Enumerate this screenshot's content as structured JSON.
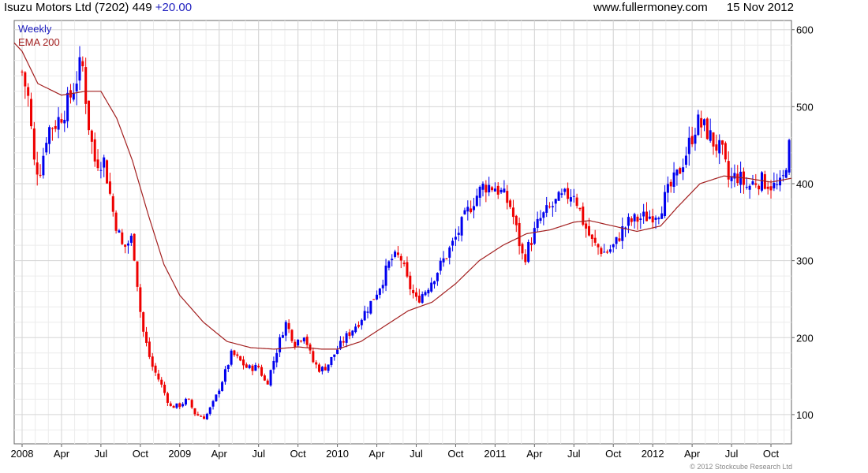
{
  "header": {
    "security": "Isuzu Motors Ltd (7202) 449",
    "change": "+20.00",
    "website": "www.fullermoney.com",
    "date": "15 Nov 2012"
  },
  "footer": {
    "copyright": "© 2012 Stockcube Research Ltd"
  },
  "chart_data": {
    "type": "candlestick",
    "title": "Isuzu Motors Ltd (7202) 449 +20.00",
    "frequency": "Weekly",
    "legend": [
      "Weekly",
      "EMA 200"
    ],
    "legend_position": "top-left",
    "colors": {
      "up": "#0000ee",
      "down": "#ee0000",
      "ema": "#a32020",
      "grid": "#d9d9d9"
    },
    "y_axis": {
      "side": "right",
      "ticks": [
        100,
        200,
        300,
        400,
        500,
        600
      ],
      "ylim": [
        62,
        612
      ]
    },
    "x_axis": {
      "ticks": [
        {
          "label": "2008",
          "t": 0
        },
        {
          "label": "Apr",
          "t": 0.25
        },
        {
          "label": "Jul",
          "t": 0.5
        },
        {
          "label": "Oct",
          "t": 0.75
        },
        {
          "label": "2009",
          "t": 1
        },
        {
          "label": "Apr",
          "t": 1.25
        },
        {
          "label": "Jul",
          "t": 1.5
        },
        {
          "label": "Oct",
          "t": 1.75
        },
        {
          "label": "2010",
          "t": 2
        },
        {
          "label": "Apr",
          "t": 2.25
        },
        {
          "label": "Jul",
          "t": 2.5
        },
        {
          "label": "Oct",
          "t": 2.75
        },
        {
          "label": "2011",
          "t": 3
        },
        {
          "label": "Apr",
          "t": 3.25
        },
        {
          "label": "Jul",
          "t": 3.5
        },
        {
          "label": "Oct",
          "t": 3.75
        },
        {
          "label": "2012",
          "t": 4
        },
        {
          "label": "Apr",
          "t": 4.25
        },
        {
          "label": "Jul",
          "t": 4.5
        },
        {
          "label": "Oct",
          "t": 4.75
        }
      ],
      "xlim": [
        -0.05,
        4.88
      ]
    },
    "price_anchors": [
      [
        0.0,
        545
      ],
      [
        0.04,
        510
      ],
      [
        0.08,
        420
      ],
      [
        0.12,
        420
      ],
      [
        0.16,
        470
      ],
      [
        0.22,
        480
      ],
      [
        0.28,
        500
      ],
      [
        0.32,
        520
      ],
      [
        0.38,
        560
      ],
      [
        0.42,
        480
      ],
      [
        0.46,
        430
      ],
      [
        0.52,
        430
      ],
      [
        0.58,
        360
      ],
      [
        0.64,
        315
      ],
      [
        0.7,
        330
      ],
      [
        0.76,
        215
      ],
      [
        0.82,
        165
      ],
      [
        0.88,
        140
      ],
      [
        0.94,
        110
      ],
      [
        1.0,
        112
      ],
      [
        1.05,
        120
      ],
      [
        1.1,
        100
      ],
      [
        1.16,
        96
      ],
      [
        1.22,
        118
      ],
      [
        1.28,
        150
      ],
      [
        1.33,
        180
      ],
      [
        1.38,
        170
      ],
      [
        1.43,
        160
      ],
      [
        1.5,
        162
      ],
      [
        1.55,
        138
      ],
      [
        1.61,
        180
      ],
      [
        1.67,
        220
      ],
      [
        1.73,
        193
      ],
      [
        1.79,
        205
      ],
      [
        1.84,
        170
      ],
      [
        1.89,
        158
      ],
      [
        1.93,
        162
      ],
      [
        2.0,
        185
      ],
      [
        2.06,
        202
      ],
      [
        2.14,
        222
      ],
      [
        2.22,
        248
      ],
      [
        2.28,
        272
      ],
      [
        2.34,
        302
      ],
      [
        2.4,
        305
      ],
      [
        2.44,
        275
      ],
      [
        2.5,
        248
      ],
      [
        2.56,
        262
      ],
      [
        2.62,
        282
      ],
      [
        2.68,
        303
      ],
      [
        2.74,
        325
      ],
      [
        2.8,
        352
      ],
      [
        2.86,
        378
      ],
      [
        2.93,
        398
      ],
      [
        3.0,
        396
      ],
      [
        3.04,
        388
      ],
      [
        3.1,
        370
      ],
      [
        3.16,
        318
      ],
      [
        3.18,
        300
      ],
      [
        3.22,
        322
      ],
      [
        3.28,
        352
      ],
      [
        3.34,
        366
      ],
      [
        3.4,
        378
      ],
      [
        3.46,
        385
      ],
      [
        3.5,
        390
      ],
      [
        3.56,
        350
      ],
      [
        3.62,
        322
      ],
      [
        3.7,
        310
      ],
      [
        3.76,
        320
      ],
      [
        3.8,
        338
      ],
      [
        3.85,
        350
      ],
      [
        3.92,
        355
      ],
      [
        3.98,
        358
      ],
      [
        4.04,
        365
      ],
      [
        4.1,
        390
      ],
      [
        4.16,
        412
      ],
      [
        4.22,
        445
      ],
      [
        4.28,
        480
      ],
      [
        4.34,
        470
      ],
      [
        4.38,
        455
      ],
      [
        4.44,
        440
      ],
      [
        4.48,
        405
      ],
      [
        4.54,
        410
      ],
      [
        4.6,
        395
      ],
      [
        4.66,
        405
      ],
      [
        4.72,
        402
      ],
      [
        4.78,
        395
      ],
      [
        4.82,
        398
      ],
      [
        4.86,
        445
      ],
      [
        4.87,
        448
      ]
    ],
    "ema_anchors": [
      [
        -0.05,
        583
      ],
      [
        0.0,
        572
      ],
      [
        0.1,
        530
      ],
      [
        0.25,
        515
      ],
      [
        0.4,
        520
      ],
      [
        0.5,
        520
      ],
      [
        0.6,
        485
      ],
      [
        0.7,
        430
      ],
      [
        0.8,
        360
      ],
      [
        0.9,
        295
      ],
      [
        1.0,
        255
      ],
      [
        1.15,
        220
      ],
      [
        1.3,
        195
      ],
      [
        1.45,
        187
      ],
      [
        1.6,
        185
      ],
      [
        1.75,
        188
      ],
      [
        1.9,
        185
      ],
      [
        2.0,
        185
      ],
      [
        2.15,
        195
      ],
      [
        2.3,
        215
      ],
      [
        2.45,
        235
      ],
      [
        2.6,
        246
      ],
      [
        2.75,
        270
      ],
      [
        2.9,
        300
      ],
      [
        3.05,
        320
      ],
      [
        3.2,
        335
      ],
      [
        3.35,
        340
      ],
      [
        3.5,
        350
      ],
      [
        3.6,
        352
      ],
      [
        3.75,
        345
      ],
      [
        3.9,
        338
      ],
      [
        4.05,
        345
      ],
      [
        4.15,
        368
      ],
      [
        4.3,
        400
      ],
      [
        4.45,
        410
      ],
      [
        4.6,
        407
      ],
      [
        4.75,
        402
      ],
      [
        4.88,
        407
      ]
    ]
  }
}
